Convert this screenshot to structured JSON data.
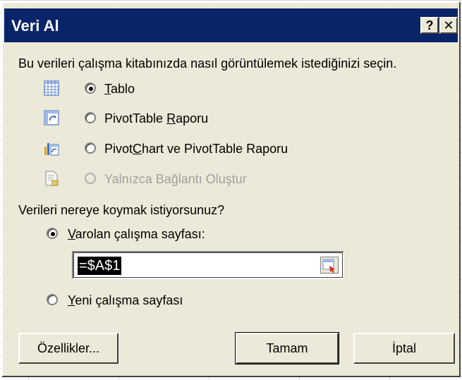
{
  "window": {
    "title": "Veri Al",
    "help_glyph": "?",
    "close_glyph": "✕"
  },
  "prompt_view": "Bu verileri çalışma kitabınızda nasıl görüntülemek istediğinizi seçin.",
  "view_options": [
    {
      "pre": "",
      "mnemonic": "T",
      "post": "ablo",
      "checked": true,
      "enabled": true,
      "icon": "table-icon"
    },
    {
      "pre": "PivotTable ",
      "mnemonic": "R",
      "post": "aporu",
      "checked": false,
      "enabled": true,
      "icon": "pivottable-icon"
    },
    {
      "pre": "Pivot",
      "mnemonic": "C",
      "post": "hart ve PivotTable Raporu",
      "checked": false,
      "enabled": true,
      "icon": "pivotchart-icon"
    },
    {
      "pre": "Yalnızca Bağlantı Oluştur",
      "mnemonic": "",
      "post": "",
      "checked": false,
      "enabled": false,
      "icon": "connection-icon"
    }
  ],
  "prompt_location": "Verileri nereye koymak istiyorsunuz?",
  "location_options": [
    {
      "mnemonic": "V",
      "post": "arolan çalışma sayfası:",
      "checked": true
    },
    {
      "mnemonic": "Y",
      "post": "eni çalışma sayfası",
      "checked": false
    }
  ],
  "range_value": "=$A$1",
  "buttons": {
    "properties": "Özellikler...",
    "ok": "Tamam",
    "cancel": "İptal"
  }
}
